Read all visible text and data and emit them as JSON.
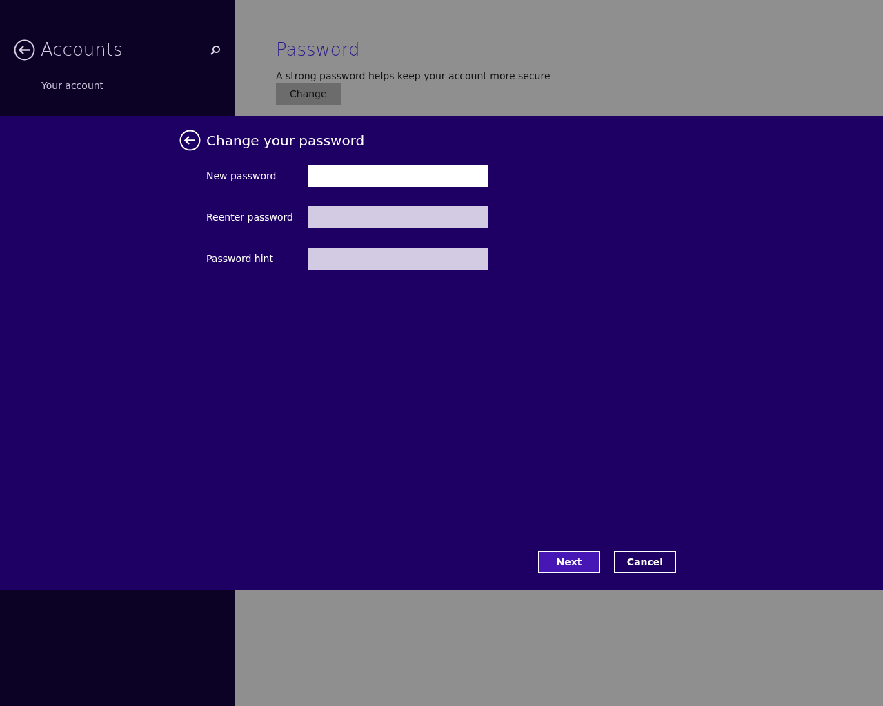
{
  "sidebar": {
    "title": "Accounts",
    "items": [
      {
        "label": "Your account",
        "selected": false
      }
    ]
  },
  "content": {
    "heading": "Password",
    "description": "A strong password helps keep your account more secure",
    "button": "Change"
  },
  "dialog": {
    "title": "Change your password",
    "fields": [
      {
        "label": "New password",
        "focused": true
      },
      {
        "label": "Reenter password",
        "focused": false
      },
      {
        "label": "Password hint",
        "focused": false
      }
    ],
    "buttons": [
      {
        "label": "Next",
        "kind": "primary"
      },
      {
        "label": "Cancel",
        "kind": "secondary"
      }
    ]
  }
}
